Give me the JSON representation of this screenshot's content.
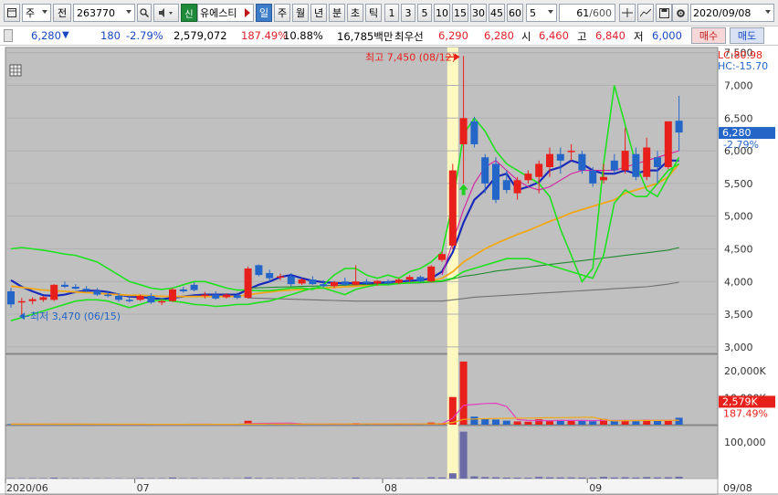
{
  "toolbar": {
    "market": "주",
    "prev_label": "전",
    "code": "263770",
    "stock_name": "유에스티",
    "credit_badge": "신",
    "periods": [
      "일",
      "주",
      "월",
      "년",
      "분",
      "초",
      "틱"
    ],
    "active_period": "일",
    "intervals": [
      "1",
      "3",
      "5",
      "10",
      "15",
      "30",
      "45",
      "60"
    ],
    "custom_interval": "5",
    "count": "61",
    "count_total": "/600",
    "date": "2020/09/08"
  },
  "quote": {
    "price": "6,280",
    "direction_arrow": "▼",
    "change": "180",
    "change_pct": "-2.79%",
    "volume": "2,579,072",
    "volume_ratio": "187.49%",
    "turnover": "10.88%",
    "trade_value": "16,785백만",
    "best_bid_label": "최우선",
    "best_ask": "6,290",
    "best_bid": "6,280",
    "open_label": "시",
    "open": "6,460",
    "high_label": "고",
    "high": "6,840",
    "low_label": "저",
    "low": "6,000",
    "buy_label": "매수",
    "sell_label": "매도"
  },
  "annotations": {
    "max_label": "최고 7,450 (08/12)",
    "min_label": "최저 3,470 (06/15)",
    "lc": "LC:80.98",
    "hc": "HC:-15.70",
    "last_price_tag": "6,280",
    "last_pct_tag": "-2.79%",
    "vol_last_tag": "2,579K",
    "vol_pct_tag": "187.49%"
  },
  "colors": {
    "up": "#e8201c",
    "down": "#2466c8",
    "panel_bg": "#c0c0c0",
    "highlight": "#fff8c0"
  },
  "chart_data": {
    "type": "candlestick",
    "price_axis": {
      "ylim": [
        3000,
        7500
      ],
      "ticks": [
        3000,
        3500,
        4000,
        4500,
        5000,
        5500,
        6000,
        6500,
        7000,
        7500
      ],
      "tick_labels": [
        "3,000",
        "3,500",
        "4,000",
        "4,500",
        "5,000",
        "5,500",
        "6,000",
        "6,500",
        "7,000",
        "7,500"
      ]
    },
    "volume_axis": {
      "ylim": [
        0,
        25000
      ],
      "ticks": [
        10000,
        20000
      ],
      "tick_labels": [
        "10,000K",
        "20,000K"
      ]
    },
    "sub_axis": {
      "ylim": [
        0,
        150000
      ],
      "ticks": [
        100000
      ],
      "tick_labels": [
        "100,000"
      ]
    },
    "x_labels": [
      {
        "index": 0,
        "label": "2020/06"
      },
      {
        "index": 12,
        "label": "07"
      },
      {
        "index": 35,
        "label": "08"
      },
      {
        "index": 54,
        "label": "09"
      },
      {
        "index": 63,
        "label": "09/08"
      }
    ],
    "highlight_index": 41,
    "candles": [
      {
        "o": 3850,
        "h": 3900,
        "l": 3600,
        "c": 3650
      },
      {
        "o": 3680,
        "h": 3750,
        "l": 3470,
        "c": 3700
      },
      {
        "o": 3700,
        "h": 3760,
        "l": 3650,
        "c": 3730
      },
      {
        "o": 3720,
        "h": 3780,
        "l": 3690,
        "c": 3760
      },
      {
        "o": 3720,
        "h": 3960,
        "l": 3700,
        "c": 3950
      },
      {
        "o": 3950,
        "h": 4000,
        "l": 3900,
        "c": 3920
      },
      {
        "o": 3920,
        "h": 3960,
        "l": 3880,
        "c": 3890
      },
      {
        "o": 3890,
        "h": 3930,
        "l": 3840,
        "c": 3860
      },
      {
        "o": 3860,
        "h": 3900,
        "l": 3780,
        "c": 3800
      },
      {
        "o": 3800,
        "h": 3850,
        "l": 3760,
        "c": 3780
      },
      {
        "o": 3780,
        "h": 3820,
        "l": 3690,
        "c": 3720
      },
      {
        "o": 3720,
        "h": 3780,
        "l": 3680,
        "c": 3700
      },
      {
        "o": 3720,
        "h": 3800,
        "l": 3700,
        "c": 3780
      },
      {
        "o": 3780,
        "h": 3820,
        "l": 3660,
        "c": 3680
      },
      {
        "o": 3690,
        "h": 3720,
        "l": 3640,
        "c": 3700
      },
      {
        "o": 3700,
        "h": 3900,
        "l": 3690,
        "c": 3880
      },
      {
        "o": 3880,
        "h": 3920,
        "l": 3830,
        "c": 3850
      },
      {
        "o": 3950,
        "h": 3990,
        "l": 3850,
        "c": 3870
      },
      {
        "o": 3780,
        "h": 3840,
        "l": 3740,
        "c": 3800
      },
      {
        "o": 3800,
        "h": 3850,
        "l": 3720,
        "c": 3740
      },
      {
        "o": 3760,
        "h": 3820,
        "l": 3740,
        "c": 3800
      },
      {
        "o": 3790,
        "h": 3830,
        "l": 3730,
        "c": 3750
      },
      {
        "o": 3750,
        "h": 4230,
        "l": 3740,
        "c": 4200
      },
      {
        "o": 4250,
        "h": 4260,
        "l": 4080,
        "c": 4100
      },
      {
        "o": 4130,
        "h": 4180,
        "l": 4000,
        "c": 4050
      },
      {
        "o": 4060,
        "h": 4120,
        "l": 4020,
        "c": 4080
      },
      {
        "o": 4080,
        "h": 4130,
        "l": 3930,
        "c": 3960
      },
      {
        "o": 3970,
        "h": 4050,
        "l": 3950,
        "c": 4030
      },
      {
        "o": 4030,
        "h": 4080,
        "l": 3950,
        "c": 3960
      },
      {
        "o": 3960,
        "h": 4020,
        "l": 3910,
        "c": 3930
      },
      {
        "o": 3930,
        "h": 4010,
        "l": 3900,
        "c": 3990
      },
      {
        "o": 4000,
        "h": 4060,
        "l": 3930,
        "c": 3950
      },
      {
        "o": 3950,
        "h": 4250,
        "l": 3940,
        "c": 4000
      },
      {
        "o": 4000,
        "h": 4040,
        "l": 3950,
        "c": 3970
      },
      {
        "o": 3970,
        "h": 4020,
        "l": 3940,
        "c": 4010
      },
      {
        "o": 4000,
        "h": 4030,
        "l": 3950,
        "c": 3970
      },
      {
        "o": 3980,
        "h": 4050,
        "l": 3960,
        "c": 4030
      },
      {
        "o": 4030,
        "h": 4100,
        "l": 4000,
        "c": 4070
      },
      {
        "o": 4070,
        "h": 4090,
        "l": 3990,
        "c": 4000
      },
      {
        "o": 4000,
        "h": 4250,
        "l": 3990,
        "c": 4230
      },
      {
        "o": 4330,
        "h": 4460,
        "l": 4300,
        "c": 4420
      },
      {
        "o": 4550,
        "h": 5800,
        "l": 4500,
        "c": 5700
      },
      {
        "o": 6100,
        "h": 7450,
        "l": 5500,
        "c": 6500
      },
      {
        "o": 6450,
        "h": 6520,
        "l": 6050,
        "c": 6100
      },
      {
        "o": 5900,
        "h": 5950,
        "l": 5350,
        "c": 5500
      },
      {
        "o": 5800,
        "h": 5900,
        "l": 5200,
        "c": 5250
      },
      {
        "o": 5550,
        "h": 5700,
        "l": 5350,
        "c": 5400
      },
      {
        "o": 5350,
        "h": 5600,
        "l": 5250,
        "c": 5550
      },
      {
        "o": 5550,
        "h": 5700,
        "l": 5500,
        "c": 5650
      },
      {
        "o": 5600,
        "h": 5850,
        "l": 5350,
        "c": 5800
      },
      {
        "o": 5750,
        "h": 6050,
        "l": 5600,
        "c": 5950
      },
      {
        "o": 5950,
        "h": 6050,
        "l": 5650,
        "c": 5850
      },
      {
        "o": 5980,
        "h": 6100,
        "l": 5850,
        "c": 6000
      },
      {
        "o": 5950,
        "h": 6000,
        "l": 5650,
        "c": 5700
      },
      {
        "o": 5700,
        "h": 5750,
        "l": 5450,
        "c": 5500
      },
      {
        "o": 5550,
        "h": 5800,
        "l": 5500,
        "c": 5600
      },
      {
        "o": 5850,
        "h": 5950,
        "l": 5650,
        "c": 5700
      },
      {
        "o": 5700,
        "h": 6350,
        "l": 5650,
        "c": 6000
      },
      {
        "o": 5950,
        "h": 6050,
        "l": 5550,
        "c": 5600
      },
      {
        "o": 5600,
        "h": 6200,
        "l": 5550,
        "c": 6050
      },
      {
        "o": 5900,
        "h": 6000,
        "l": 5500,
        "c": 5750
      },
      {
        "o": 5750,
        "h": 6450,
        "l": 5720,
        "c": 6450
      },
      {
        "o": 6460,
        "h": 6840,
        "l": 6000,
        "c": 6280
      }
    ],
    "volume": [
      210,
      180,
      160,
      170,
      380,
      150,
      140,
      120,
      110,
      120,
      100,
      90,
      130,
      110,
      100,
      250,
      120,
      130,
      100,
      90,
      110,
      100,
      1450,
      470,
      300,
      240,
      200,
      260,
      180,
      170,
      200,
      180,
      560,
      160,
      150,
      150,
      160,
      220,
      170,
      800,
      560,
      10300,
      23500,
      3000,
      2100,
      1900,
      1500,
      1200,
      1100,
      2000,
      1700,
      1500,
      1600,
      1400,
      1300,
      2100,
      1400,
      1700,
      1300,
      1800,
      1400,
      1600,
      2579
    ],
    "sub_values": [
      1000,
      1200,
      1300,
      1200,
      2400,
      1100,
      1100,
      1000,
      900,
      1000,
      900,
      800,
      1500,
      1000,
      1100,
      2900,
      1300,
      1400,
      1000,
      900,
      1200,
      1000,
      3200,
      1800,
      1400,
      1200,
      1100,
      1200,
      1000,
      1000,
      1100,
      1000,
      2600,
      1000,
      900,
      900,
      1000,
      1300,
      1100,
      3500,
      3100,
      14500,
      128500,
      6000,
      4200,
      3500,
      2800,
      2500,
      2300,
      4500,
      3300,
      3100,
      3200,
      2800,
      2700,
      4600,
      3000,
      3600,
      2900,
      4000,
      3200,
      3500,
      4800
    ],
    "price_lines": [
      {
        "name": "MA5",
        "color": "#1a2ab8",
        "values": [
          4020,
          3920,
          3850,
          3790,
          3780,
          3800,
          3840,
          3860,
          3860,
          3840,
          3800,
          3770,
          3760,
          3750,
          3730,
          3750,
          3770,
          3790,
          3800,
          3800,
          3800,
          3800,
          3880,
          3950,
          4000,
          4070,
          4100,
          4050,
          4010,
          3990,
          3980,
          3970,
          3980,
          3970,
          3980,
          3990,
          4000,
          4010,
          4020,
          4050,
          4150,
          4450,
          4900,
          5250,
          5400,
          5600,
          5650,
          5400,
          5450,
          5520,
          5700,
          5750,
          5850,
          5800,
          5700,
          5650,
          5650,
          5700,
          5650,
          5700,
          5700,
          5850,
          5850
        ]
      },
      {
        "name": "MA20",
        "color": "#f0a818",
        "values": [
          3930,
          3910,
          3890,
          3870,
          3860,
          3850,
          3840,
          3830,
          3820,
          3810,
          3800,
          3790,
          3790,
          3780,
          3775,
          3770,
          3770,
          3770,
          3770,
          3770,
          3770,
          3775,
          3800,
          3820,
          3840,
          3860,
          3870,
          3880,
          3890,
          3900,
          3910,
          3920,
          3930,
          3940,
          3950,
          3960,
          3970,
          3980,
          3990,
          4010,
          4050,
          4150,
          4300,
          4400,
          4500,
          4580,
          4650,
          4720,
          4780,
          4850,
          4920,
          4980,
          5050,
          5100,
          5150,
          5200,
          5250,
          5350,
          5400,
          5450,
          5500,
          5600,
          5800
        ]
      },
      {
        "name": "MA60",
        "color": "#208a30",
        "values": [
          null,
          null,
          null,
          null,
          null,
          null,
          null,
          null,
          null,
          null,
          null,
          null,
          null,
          null,
          null,
          null,
          null,
          null,
          null,
          null,
          null,
          null,
          3900,
          3905,
          3910,
          3915,
          3920,
          3925,
          3930,
          3935,
          3940,
          3945,
          3950,
          3955,
          3960,
          3965,
          3970,
          3975,
          3980,
          3990,
          4000,
          4040,
          4080,
          4100,
          4130,
          4160,
          4180,
          4200,
          4220,
          4240,
          4260,
          4280,
          4300,
          4320,
          4340,
          4360,
          4380,
          4400,
          4420,
          4440,
          4460,
          4480,
          4520
        ]
      },
      {
        "name": "MA120",
        "color": "#707070",
        "values": [
          null,
          null,
          null,
          null,
          null,
          null,
          null,
          null,
          null,
          null,
          null,
          null,
          null,
          null,
          null,
          null,
          null,
          null,
          null,
          null,
          null,
          null,
          3750,
          3745,
          3740,
          3735,
          3730,
          3725,
          3720,
          3715,
          3710,
          3705,
          3700,
          3700,
          3700,
          3700,
          3700,
          3700,
          3700,
          3700,
          3700,
          3720,
          3740,
          3760,
          3770,
          3780,
          3790,
          3800,
          3810,
          3820,
          3830,
          3840,
          3850,
          3860,
          3870,
          3880,
          3890,
          3900,
          3910,
          3920,
          3940,
          3960,
          3990
        ]
      },
      {
        "name": "BB-upper",
        "color": "#20e020",
        "values": [
          4500,
          4520,
          4500,
          4480,
          4450,
          4420,
          4400,
          4350,
          4300,
          4200,
          4100,
          4000,
          3950,
          3900,
          3880,
          3900,
          3950,
          4000,
          4000,
          3950,
          3900,
          3870,
          3870,
          3860,
          3860,
          3880,
          3900,
          3900,
          3880,
          3950,
          4100,
          4200,
          4200,
          4100,
          4050,
          4100,
          4050,
          4150,
          4200,
          4300,
          4450,
          5200,
          6250,
          6500,
          6300,
          6000,
          5800,
          5700,
          5600,
          5500,
          5300,
          4800,
          4400,
          4000,
          4200,
          5800,
          7000,
          6400,
          5800,
          5400,
          5300,
          5600,
          5900
        ]
      },
      {
        "name": "BB-lower",
        "color": "#20e020",
        "values": [
          3400,
          3450,
          3500,
          3550,
          3600,
          3650,
          3700,
          3720,
          3720,
          3700,
          3650,
          3600,
          3650,
          3700,
          3720,
          3700,
          3680,
          3650,
          3640,
          3620,
          3630,
          3650,
          3650,
          3680,
          3700,
          3750,
          3800,
          3850,
          3900,
          3900,
          3850,
          3800,
          3880,
          3920,
          3950,
          3950,
          3970,
          3980,
          3990,
          4000,
          4010,
          4050,
          4150,
          4200,
          4250,
          4300,
          4350,
          4350,
          4350,
          4300,
          4250,
          4200,
          4150,
          4100,
          4050,
          4400,
          5200,
          5400,
          5300,
          5300,
          5500,
          5700,
          5800
        ]
      },
      {
        "name": "Envelope",
        "color": "#d020a0",
        "values": [
          null,
          null,
          null,
          null,
          null,
          null,
          null,
          null,
          null,
          null,
          null,
          null,
          null,
          null,
          null,
          null,
          null,
          null,
          null,
          null,
          null,
          null,
          null,
          null,
          null,
          null,
          null,
          null,
          null,
          null,
          null,
          null,
          null,
          null,
          null,
          null,
          null,
          null,
          null,
          null,
          4100,
          4600,
          5100,
          5500,
          5750,
          5850,
          5700,
          5550,
          5450,
          5400,
          5450,
          5550,
          5650,
          5700,
          5700,
          5700,
          5700,
          5750,
          5800,
          5850,
          5900,
          5950,
          6000
        ]
      }
    ],
    "volume_lines": [
      {
        "name": "VMA5",
        "color": "#e040c0",
        "values": [
          200,
          190,
          180,
          180,
          220,
          200,
          190,
          180,
          170,
          160,
          150,
          140,
          130,
          120,
          110,
          140,
          150,
          160,
          160,
          150,
          110,
          100,
          400,
          470,
          520,
          580,
          600,
          300,
          250,
          210,
          200,
          190,
          250,
          260,
          250,
          230,
          240,
          250,
          260,
          300,
          370,
          2400,
          7200,
          7500,
          7900,
          8000,
          6800,
          1900,
          1560,
          1500,
          1500,
          1580,
          1560,
          1550,
          1500,
          1640,
          1540,
          1560,
          1540,
          1620,
          1540,
          1560,
          1600
        ]
      },
      {
        "name": "VMA20",
        "color": "#f0a818",
        "values": [
          200,
          200,
          200,
          200,
          210,
          210,
          200,
          190,
          180,
          170,
          160,
          160,
          160,
          150,
          150,
          150,
          150,
          150,
          150,
          150,
          150,
          150,
          200,
          220,
          230,
          240,
          250,
          250,
          250,
          250,
          260,
          250,
          260,
          260,
          260,
          260,
          260,
          270,
          270,
          300,
          320,
          820,
          1980,
          2120,
          2220,
          2300,
          2380,
          2420,
          2460,
          2520,
          2580,
          2620,
          2680,
          2740,
          2780,
          1900,
          1400,
          1480,
          1520,
          1560,
          1580,
          1600,
          1650
        ]
      }
    ]
  }
}
